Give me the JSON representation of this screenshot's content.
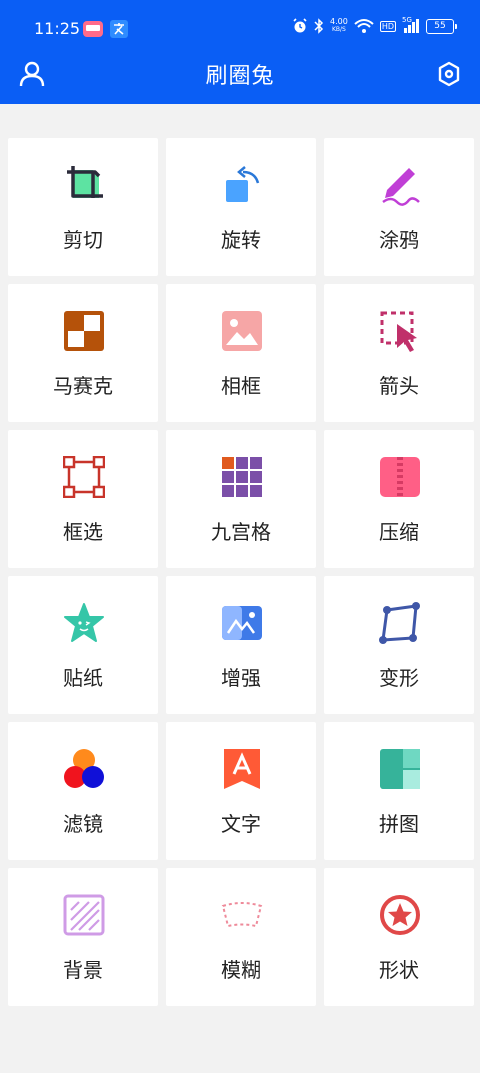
{
  "status_bar": {
    "time": "11:25",
    "network_speed": "4.00",
    "network_unit": "KB/S",
    "hd": "HD",
    "signal": "5G",
    "battery": "55"
  },
  "app_bar": {
    "title": "刷圈兔"
  },
  "tools": [
    {
      "label": "剪切",
      "icon": "crop-icon"
    },
    {
      "label": "旋转",
      "icon": "rotate-icon"
    },
    {
      "label": "涂鸦",
      "icon": "pen-doodle-icon"
    },
    {
      "label": "马赛克",
      "icon": "mosaic-icon"
    },
    {
      "label": "相框",
      "icon": "photo-frame-icon"
    },
    {
      "label": "箭头",
      "icon": "arrow-cursor-icon"
    },
    {
      "label": "框选",
      "icon": "box-select-icon"
    },
    {
      "label": "九宫格",
      "icon": "nine-grid-icon"
    },
    {
      "label": "压缩",
      "icon": "zip-compress-icon"
    },
    {
      "label": "贴纸",
      "icon": "star-sticker-icon"
    },
    {
      "label": "增强",
      "icon": "enhance-image-icon"
    },
    {
      "label": "变形",
      "icon": "transform-icon"
    },
    {
      "label": "滤镜",
      "icon": "color-filter-icon"
    },
    {
      "label": "文字",
      "icon": "text-icon"
    },
    {
      "label": "拼图",
      "icon": "collage-icon"
    },
    {
      "label": "背景",
      "icon": "background-icon"
    },
    {
      "label": "模糊",
      "icon": "blur-icon"
    },
    {
      "label": "形状",
      "icon": "shape-star-icon"
    }
  ],
  "colors": {
    "header": "#0a5ef5",
    "background": "#f2f2f2",
    "tile": "#ffffff"
  }
}
